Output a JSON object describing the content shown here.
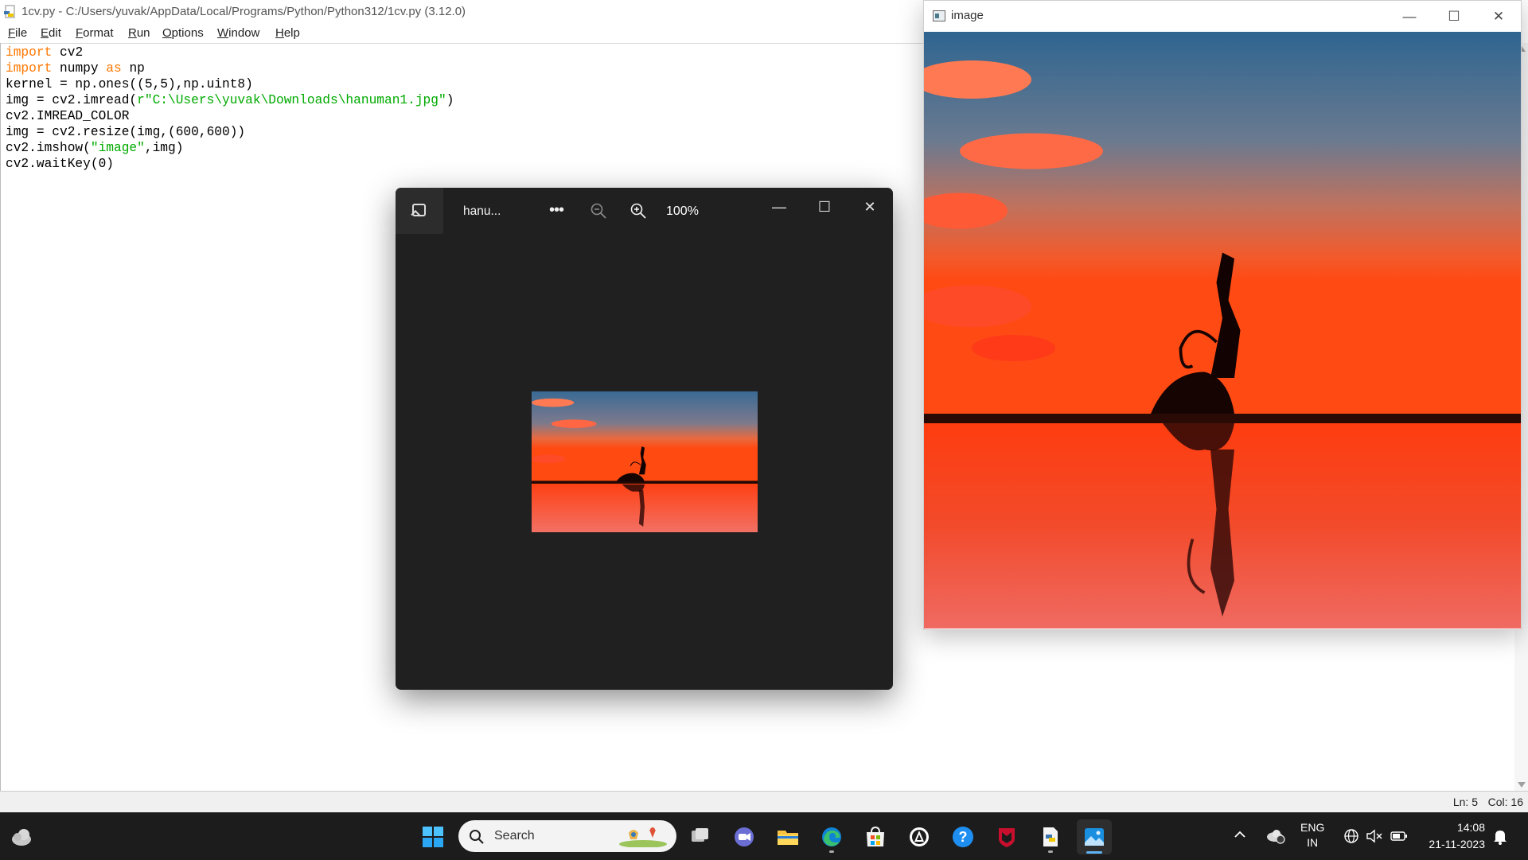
{
  "idle": {
    "title": "1cv.py - C:/Users/yuvak/AppData/Local/Programs/Python/Python312/1cv.py (3.12.0)",
    "menu": [
      {
        "u": "F",
        "rest": "ile"
      },
      {
        "u": "E",
        "rest": "dit"
      },
      {
        "u": "F",
        "rest": "ormat"
      },
      {
        "u": "R",
        "rest": "un"
      },
      {
        "u": "O",
        "rest": "ptions"
      },
      {
        "u": "W",
        "rest": "indow"
      },
      {
        "u": "H",
        "rest": "elp"
      }
    ],
    "code": [
      [
        {
          "t": "import",
          "c": "kw"
        },
        {
          "t": " cv2"
        }
      ],
      [
        {
          "t": "import",
          "c": "kw"
        },
        {
          "t": " numpy "
        },
        {
          "t": "as",
          "c": "kw"
        },
        {
          "t": " np"
        }
      ],
      [
        {
          "t": "kernel = np.ones((5,5),np.uint8)"
        }
      ],
      [
        {
          "t": "img = cv2.imread("
        },
        {
          "t": "r\"C:\\Users\\yuvak\\Downloads\\hanuman1.jpg\"",
          "c": "str"
        },
        {
          "t": ")"
        }
      ],
      [
        {
          "t": "cv2.IMREAD_COLOR"
        }
      ],
      [
        {
          "t": "img = cv2.resize(img,(600,600))"
        }
      ],
      [
        {
          "t": "cv2.imshow("
        },
        {
          "t": "\"image\"",
          "c": "str"
        },
        {
          "t": ",img)"
        }
      ],
      [
        {
          "t": "cv2.waitKey(0)"
        }
      ]
    ],
    "status": {
      "line": "Ln: 5",
      "col": "Col: 16"
    }
  },
  "cv_window": {
    "title": "image",
    "minimize": "—",
    "maximize": "☐",
    "close": "✕"
  },
  "photos": {
    "title": "hanu...",
    "more": "•••",
    "zoom": "100%",
    "minimize": "—",
    "maximize": "☐",
    "close": "✕"
  },
  "taskbar": {
    "search_label": "Search",
    "lang_top": "ENG",
    "lang_bottom": "IN",
    "time": "14:08",
    "date": "21-11-2023"
  },
  "colors": {
    "keyword": "#ff7700",
    "string": "#00aa00",
    "taskbar_bg": "#1c1c1c",
    "photos_bg": "#202020",
    "accent": "#5fb2f2"
  }
}
